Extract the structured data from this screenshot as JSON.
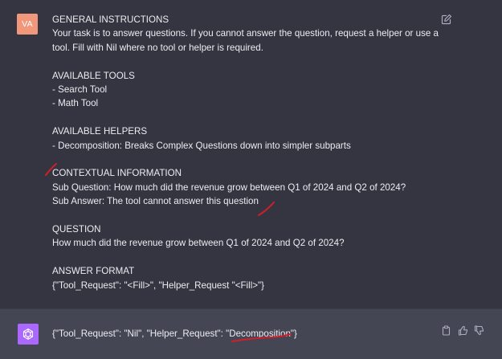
{
  "user_message": {
    "avatar_initials": "VA",
    "avatar_color": "#f0977c",
    "lines": [
      "GENERAL INSTRUCTIONS",
      "Your task is to answer questions. If you cannot answer the question, request a helper or use a",
      "tool. Fill with Nil where no tool or helper is required.",
      "",
      "AVAILABLE TOOLS",
      "- Search Tool",
      "- Math Tool",
      "",
      "AVAILABLE HELPERS",
      "- Decomposition: Breaks Complex Questions down into simpler subparts",
      "",
      "CONTEXTUAL INFORMATION",
      "Sub Question: How much did the revenue grow between Q1 of 2024 and Q2 of 2024?",
      "Sub Answer:  The tool cannot answer this question",
      "",
      "QUESTION",
      "How much did the revenue grow between Q1 of 2024 and Q2 of 2024?",
      "",
      "ANSWER FORMAT",
      "{\"Tool_Request\": \"<Fill>\", \"Helper_Request \"<Fill>\"}"
    ]
  },
  "assistant_message": {
    "avatar_color": "#ab68ff",
    "text": "{\"Tool_Request\": \"Nil\", \"Helper_Request\": \"Decomposition\"}"
  },
  "icons": {
    "edit": "edit-icon",
    "copy": "clipboard-icon",
    "thumbs_up": "thumbs-up-icon",
    "thumbs_down": "thumbs-down-icon",
    "assistant_logo": "openai-logo-icon"
  },
  "colors": {
    "background": "#343541",
    "response_background": "#444654",
    "text": "#ececf1",
    "annotation": "#d11f2a"
  }
}
